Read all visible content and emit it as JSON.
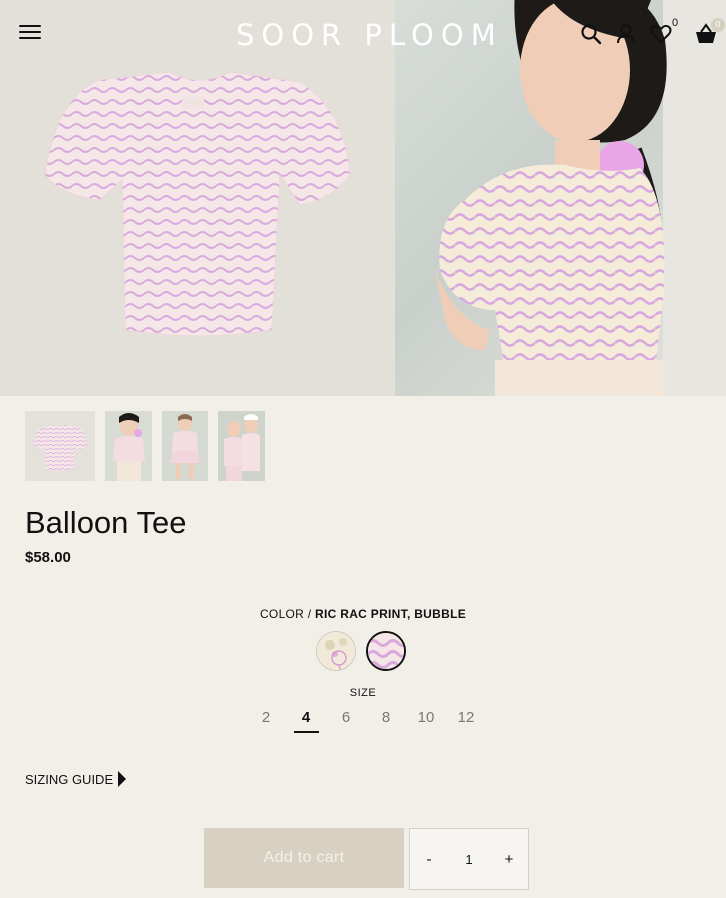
{
  "header": {
    "logo": "SOOR PLOOM",
    "wishlist_count": "0",
    "cart_count": "0",
    "icons": [
      "menu-icon",
      "search-icon",
      "account-icon",
      "heart-icon",
      "basket-icon"
    ]
  },
  "gallery": {
    "thumbnail_count": 4
  },
  "product": {
    "title": "Balloon Tee",
    "price": "$58.00"
  },
  "color": {
    "label": "COLOR / ",
    "selected": "RIC RAC PRINT, BUBBLE"
  },
  "size": {
    "label": "SIZE",
    "options": [
      "2",
      "4",
      "6",
      "8",
      "10",
      "12"
    ],
    "selected": "4"
  },
  "sizing_guide": "SIZING GUIDE",
  "cart": {
    "add_label": "Add to cart",
    "minus": "-",
    "quantity": "1",
    "plus": "+"
  },
  "colors": {
    "background": "#f2efe9",
    "button": "#d8d1c2",
    "stripe_pink": "#d9a9dc",
    "shirt_base": "#f4e3e6"
  }
}
